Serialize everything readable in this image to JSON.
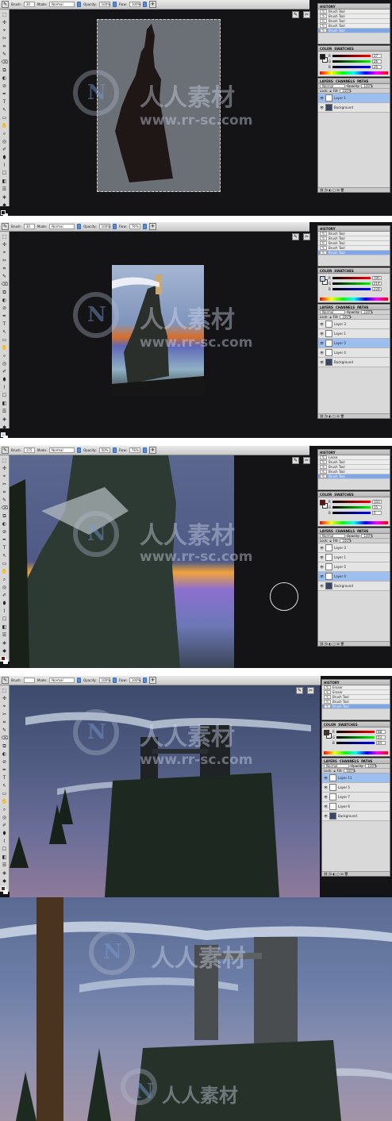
{
  "colors": {
    "app_bg": "#141416",
    "panel_bg": "#d9d9d9",
    "selection": "#9dbff0",
    "history_sel": "#7fa6e6",
    "accent_blue": "#5a8bd0"
  },
  "watermark": {
    "cn": "人人素材",
    "url": "www.rr-sc.com",
    "logo_letter": "N"
  },
  "frames": [
    {
      "options": {
        "tool_icon": "brush-icon",
        "brush_label": "Brush:",
        "brush_size": "30",
        "mode_label": "Mode:",
        "mode": "Normal",
        "opacity_label": "Opacity:",
        "opacity": "100%",
        "flow_label": "Flow:",
        "flow": "100%"
      },
      "history": {
        "title": "HISTORY",
        "items": [
          "Brush Tool",
          "Brush Tool",
          "Brush Tool",
          "Brush Tool",
          "Brush Tool"
        ],
        "selected": 4
      },
      "color": {
        "tabs": [
          "COLOR",
          "SWATCHES"
        ],
        "sliders": [
          {
            "k": "R",
            "v": "27"
          },
          {
            "k": "G",
            "v": "26"
          },
          {
            "k": "B",
            "v": "26"
          }
        ],
        "fg": "#1b1a1a",
        "bg": "#ffffff"
      },
      "layers": {
        "tabs": [
          "LAYERS",
          "CHANNELS",
          "PATHS"
        ],
        "mode": "Normal",
        "opacity_label": "Opacity:",
        "opacity": "100%",
        "lock_label": "Lock:",
        "fill_label": "Fill:",
        "fill": "100%",
        "rows": [
          {
            "name": "Layer 1",
            "sel": true
          },
          {
            "name": "Background",
            "sel": false
          }
        ]
      }
    },
    {
      "options": {
        "tool_icon": "brush-icon",
        "brush_label": "Brush:",
        "brush_size": "30",
        "mode_label": "Mode:",
        "mode": "Normal",
        "opacity_label": "Opacity:",
        "opacity": "100%",
        "flow_label": "Flow:",
        "flow": "76%"
      },
      "history": {
        "title": "HISTORY",
        "items": [
          "Brush Tool",
          "Brush Tool",
          "Brush Tool",
          "Brush Tool",
          "Brush Tool"
        ],
        "selected": 4
      },
      "color": {
        "tabs": [
          "COLOR",
          "SWATCHES"
        ],
        "sliders": [
          {
            "k": "R",
            "v": "195"
          },
          {
            "k": "G",
            "v": "214"
          },
          {
            "k": "B",
            "v": "228"
          }
        ],
        "fg": "#c3d6e4",
        "bg": "#ffffff"
      },
      "layers": {
        "tabs": [
          "LAYERS",
          "CHANNELS",
          "PATHS"
        ],
        "mode": "Normal",
        "opacity_label": "Opacity:",
        "opacity": "100%",
        "lock_label": "Lock:",
        "fill_label": "Fill:",
        "fill": "100%",
        "rows": [
          {
            "name": "Layer 3",
            "sel": false
          },
          {
            "name": "Layer 1",
            "sel": false
          },
          {
            "name": "Layer 5",
            "sel": true
          },
          {
            "name": "Layer 4",
            "sel": false
          },
          {
            "name": "Background",
            "sel": false
          }
        ]
      }
    },
    {
      "options": {
        "tool_icon": "brush-icon",
        "brush_label": "Brush:",
        "brush_size": "175",
        "mode_label": "Mode:",
        "mode": "Normal",
        "opacity_label": "Opacity:",
        "opacity": "50%",
        "flow_label": "Flow:",
        "flow": "76%"
      },
      "history": {
        "title": "HISTORY",
        "items": [
          "Lasso",
          "Brush Tool",
          "Brush Tool",
          "Brush Tool",
          "Brush Tool"
        ],
        "selected": 4
      },
      "color": {
        "tabs": [
          "COLOR",
          "SWATCHES"
        ],
        "sliders": [
          {
            "k": "R",
            "v": "103"
          },
          {
            "k": "G",
            "v": "15"
          },
          {
            "k": "B",
            "v": "0"
          }
        ],
        "fg": "#670f00",
        "bg": "#ffffff"
      },
      "layers": {
        "tabs": [
          "LAYERS",
          "CHANNELS",
          "PATHS"
        ],
        "mode": "Normal",
        "opacity_label": "Opacity:",
        "opacity": "100%",
        "lock_label": "Lock:",
        "fill_label": "Fill:",
        "fill": "100%",
        "rows": [
          {
            "name": "Layer 3",
            "sel": false
          },
          {
            "name": "Layer 1",
            "sel": false
          },
          {
            "name": "Layer 5",
            "sel": false
          },
          {
            "name": "Layer 4",
            "sel": true
          },
          {
            "name": "Background",
            "sel": false
          }
        ]
      }
    },
    {
      "options": {
        "tool_icon": "brush-icon",
        "brush_label": "Brush:",
        "brush_size": "",
        "mode_label": "Mode:",
        "mode": "Normal",
        "opacity_label": "Opacity:",
        "opacity": "100%",
        "flow_label": "Flow:",
        "flow": "100%"
      },
      "history": {
        "title": "HISTORY",
        "items": [
          "Eraser",
          "Eraser",
          "Brush Tool",
          "Brush Tool",
          "Brush Tool"
        ],
        "selected": 4
      },
      "color": {
        "tabs": [
          "COLOR",
          "SWATCHES"
        ],
        "sliders": [
          {
            "k": "R",
            "v": "68"
          },
          {
            "k": "G",
            "v": "53"
          },
          {
            "k": "B",
            "v": "44"
          }
        ],
        "fg": "#44352c",
        "bg": "#ffffff"
      },
      "layers": {
        "tabs": [
          "LAYERS",
          "CHANNELS",
          "PATHS"
        ],
        "mode": "Normal",
        "opacity_label": "Opacity:",
        "opacity": "100%",
        "lock_label": "Lock:",
        "fill_label": "Fill:",
        "fill": "100%",
        "rows": [
          {
            "name": "Layer 11",
            "sel": true
          },
          {
            "name": "Layer 5",
            "sel": false
          },
          {
            "name": "Layer 7",
            "sel": false
          },
          {
            "name": "Layer 6",
            "sel": false
          },
          {
            "name": "Background",
            "sel": false
          }
        ]
      }
    }
  ]
}
